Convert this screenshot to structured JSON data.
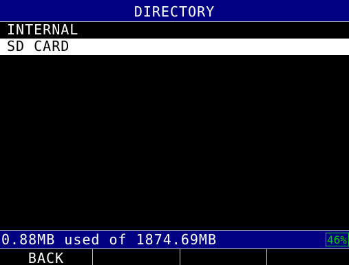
{
  "title": "DIRECTORY",
  "directory": {
    "items": [
      {
        "label": "INTERNAL",
        "selected": false
      },
      {
        "label": "SD CARD",
        "selected": true
      }
    ]
  },
  "status": {
    "usage_text": "0.88MB used of 1874.69MB",
    "percent_text": "46%"
  },
  "softkeys": [
    {
      "label": "BACK"
    },
    {
      "label": ""
    },
    {
      "label": ""
    },
    {
      "label": ""
    }
  ],
  "colors": {
    "title_bar_bg": "#000080",
    "background": "#000000",
    "selected_bg": "#ffffff",
    "percent_indicator": "#00d000"
  }
}
